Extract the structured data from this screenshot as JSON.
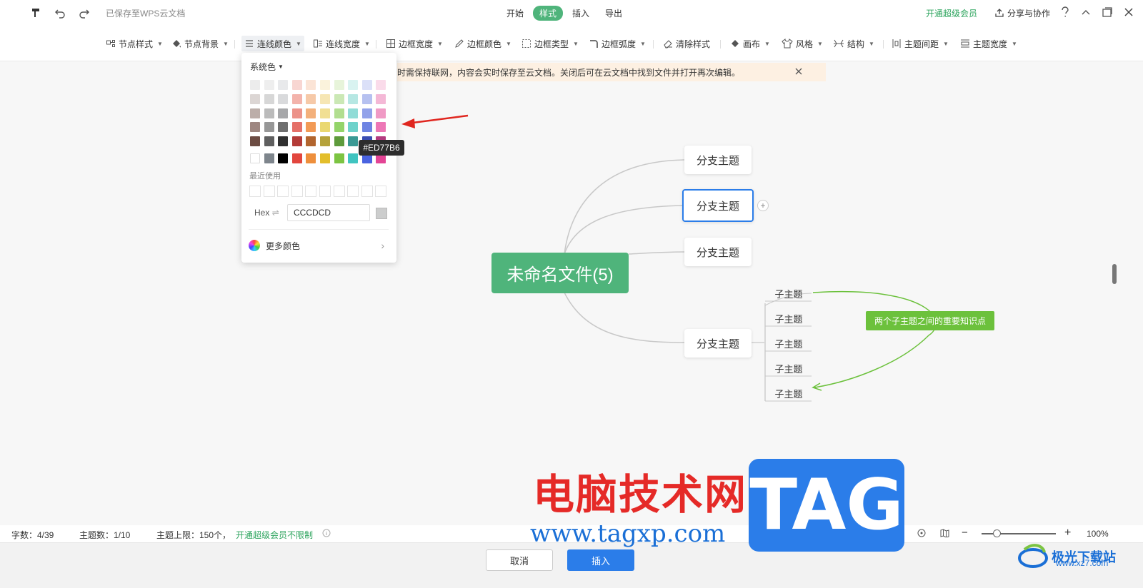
{
  "topbar": {
    "save_status": "已保存至WPS云文档",
    "tabs": [
      "开始",
      "样式",
      "插入",
      "导出"
    ],
    "active_tab": "样式",
    "vip": "开通超级会员",
    "share": "分享与协作"
  },
  "toolbar": {
    "items": [
      "节点样式",
      "节点背景",
      "连线颜色",
      "连线宽度",
      "边框宽度",
      "边框颜色",
      "边框类型",
      "边框弧度",
      "清除样式",
      "画布",
      "风格",
      "结构",
      "主题间距",
      "主题宽度"
    ],
    "active_item": "连线颜色"
  },
  "notice": {
    "text": "时需保持联网，内容会实时保存至云文档。关闭后可在云文档中找到文件并打开再次编辑。"
  },
  "color_popup": {
    "palette_label": "系统色",
    "recent_label": "最近使用",
    "hex_label": "Hex",
    "hex_value": "CCCDCD",
    "more_colors": "更多颜色",
    "tooltip": "#ED77B6",
    "swatch_rows": [
      [
        "#ececec",
        "#eeeeee",
        "#e8e9eb",
        "#f8d6d2",
        "#fbe4d6",
        "#fbf3dc",
        "#e7f4da",
        "#d9f3f1",
        "#dbe0f8",
        "#fadbea"
      ],
      [
        "#dcd6d4",
        "#d7d7d7",
        "#d9dadc",
        "#f3b3ab",
        "#f6c9a8",
        "#f6e6b4",
        "#cbe8b5",
        "#b6e7e3",
        "#b6c1f0",
        "#f4b8d6"
      ],
      [
        "#bcaea9",
        "#bbbbbb",
        "#a6a7a9",
        "#ec9289",
        "#f3b07b",
        "#f1df93",
        "#b2de90",
        "#91dcd7",
        "#92a2ea",
        "#f09ac5"
      ],
      [
        "#9e8781",
        "#979797",
        "#6f6f6f",
        "#e57068",
        "#f29a55",
        "#ead871",
        "#94d46a",
        "#6ed2cb",
        "#6e84e3",
        "#ed77b6"
      ],
      [
        "#6c4c43",
        "#5f5f5f",
        "#303030",
        "#b33b37",
        "#b2652e",
        "#b5a23b",
        "#5e9b3c",
        "#3a9994",
        "#3a4db1",
        "#b33a7f"
      ],
      [
        "#ffffff",
        "#7e858c",
        "#000000",
        "#e2463e",
        "#ee8f3c",
        "#e3be2b",
        "#7cc442",
        "#40c4c0",
        "#4a63e0",
        "#e34495"
      ]
    ]
  },
  "mindmap": {
    "root": "未命名文件(5)",
    "branches": [
      "分支主题",
      "分支主题",
      "分支主题",
      "分支主题"
    ],
    "subtopics": [
      "子主题",
      "子主题",
      "子主题",
      "子主题",
      "子主题"
    ],
    "summary": "两个子主题之间的重要知识点",
    "plus": "+"
  },
  "statusbar": {
    "words": "字数：4/39",
    "topics": "主题数：1/10",
    "limit": "主题上限：150个，",
    "vip_unlimited": "开通超级会员不限制",
    "zoom": "100%",
    "zoom_level": 0.2
  },
  "bottombar": {
    "cancel": "取消",
    "insert": "插入"
  },
  "watermark": {
    "cn": "电脑技术网",
    "url": "www.tagxp.com",
    "tag": "TAG",
    "brand": "极光下载站",
    "brand_url": "www.xz7.com"
  },
  "colors": {
    "root_green": "#4fb47b",
    "selection_blue": "#2b7de9",
    "summary_green": "#6cc13c",
    "arrow_red": "#e0261f"
  }
}
